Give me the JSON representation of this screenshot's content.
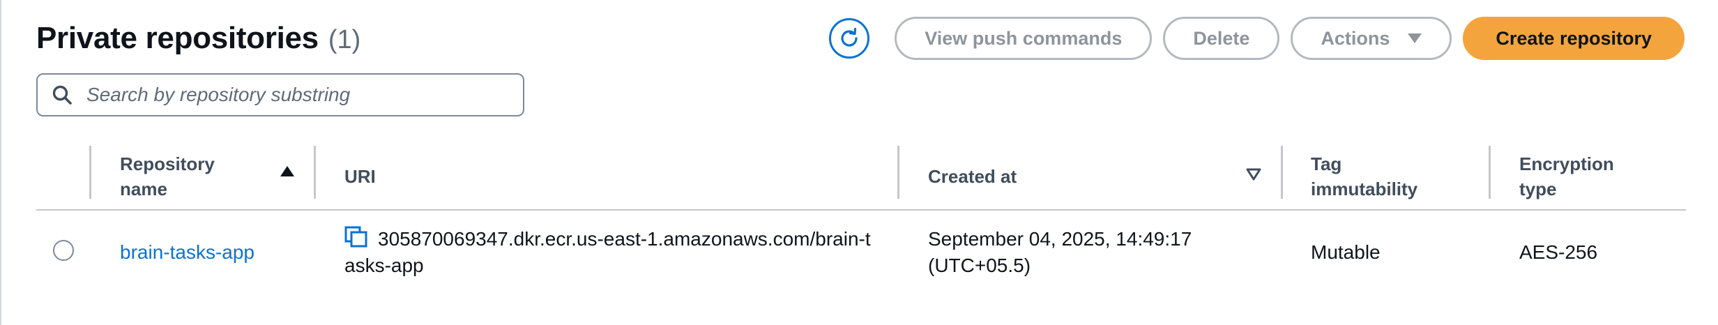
{
  "header": {
    "title": "Private repositories",
    "count": "(1)"
  },
  "toolbar": {
    "refresh_icon": "refresh-icon",
    "view_push_label": "View push commands",
    "delete_label": "Delete",
    "actions_label": "Actions",
    "create_label": "Create repository"
  },
  "search": {
    "placeholder": "Search by repository substring",
    "value": ""
  },
  "table": {
    "columns": [
      {
        "label": "Repository name",
        "line1": "Repository",
        "line2": "name",
        "sort": "ascending"
      },
      {
        "label": "URI"
      },
      {
        "label": "Created at",
        "sort": "none"
      },
      {
        "label": "Tag immutability",
        "line1": "Tag",
        "line2": "immutability"
      },
      {
        "label": "Encryption type",
        "line1": "Encryption",
        "line2": "type"
      }
    ],
    "rows": [
      {
        "name": "brain-tasks-app",
        "uri": "305870069347.dkr.ecr.us-east-1.amazonaws.com/brain-tasks-app",
        "created_line1": "September 04, 2025, 14:49:17",
        "created_line2": "(UTC+05.5)",
        "tag_immutability": "Mutable",
        "encryption": "AES-256"
      }
    ]
  },
  "colors": {
    "primary_button": "#f3a43c",
    "link": "#0972d3",
    "disabled_text": "#8d949c"
  }
}
